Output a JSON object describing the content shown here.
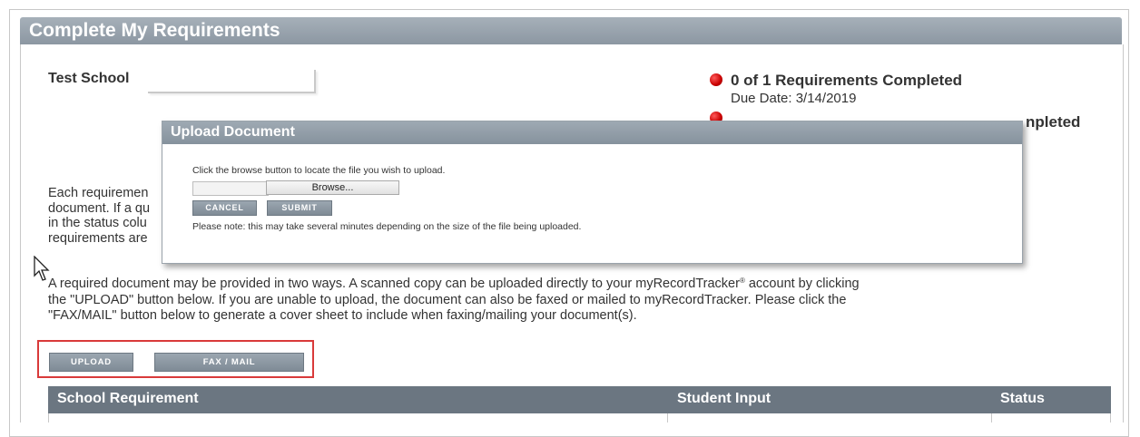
{
  "section": {
    "title": "Complete My Requirements"
  },
  "school": {
    "label": "Test School",
    "value": ""
  },
  "status": {
    "requirements_completed": "0 of 1 Requirements Completed",
    "due_date": "Due Date: 3/14/2019",
    "requirements_completed_2": "npleted",
    "indicator_color": "#cc0000"
  },
  "instructions": {
    "lines": [
      "Each requiremen",
      "document. If a qu",
      "in the status colu",
      "requirements are"
    ]
  },
  "upload_info": {
    "line1": "A required document may be provided in two ways. A scanned copy can be uploaded directly to your myRecordTracker",
    "registered": "®",
    "line1_end": " account by clicking",
    "line2": "the \"UPLOAD\" button below. If you are unable to upload, the document can also be faxed or mailed to myRecordTracker. Please click the",
    "line3": "\"FAX/MAIL\" button below to generate a cover sheet to include when faxing/mailing your document(s)."
  },
  "buttons": {
    "upload": "UPLOAD",
    "fax_mail": "FAX / MAIL"
  },
  "table": {
    "columns": [
      "School Requirement",
      "Student Input",
      "Status"
    ]
  },
  "modal": {
    "title": "Upload Document",
    "instruction": "Click the browse button to locate the file you wish to upload.",
    "file_value": "",
    "browse_label": "Browse...",
    "cancel_label": "CANCEL",
    "submit_label": "SUBMIT",
    "note": "Please note: this may take several minutes depending on the size of the file being uploaded."
  },
  "colors": {
    "header": "#8c97a2",
    "table_header": "#6b7681",
    "highlight": "#d93a3a"
  },
  "icons": {
    "cursor": "mouse-pointer-icon"
  }
}
